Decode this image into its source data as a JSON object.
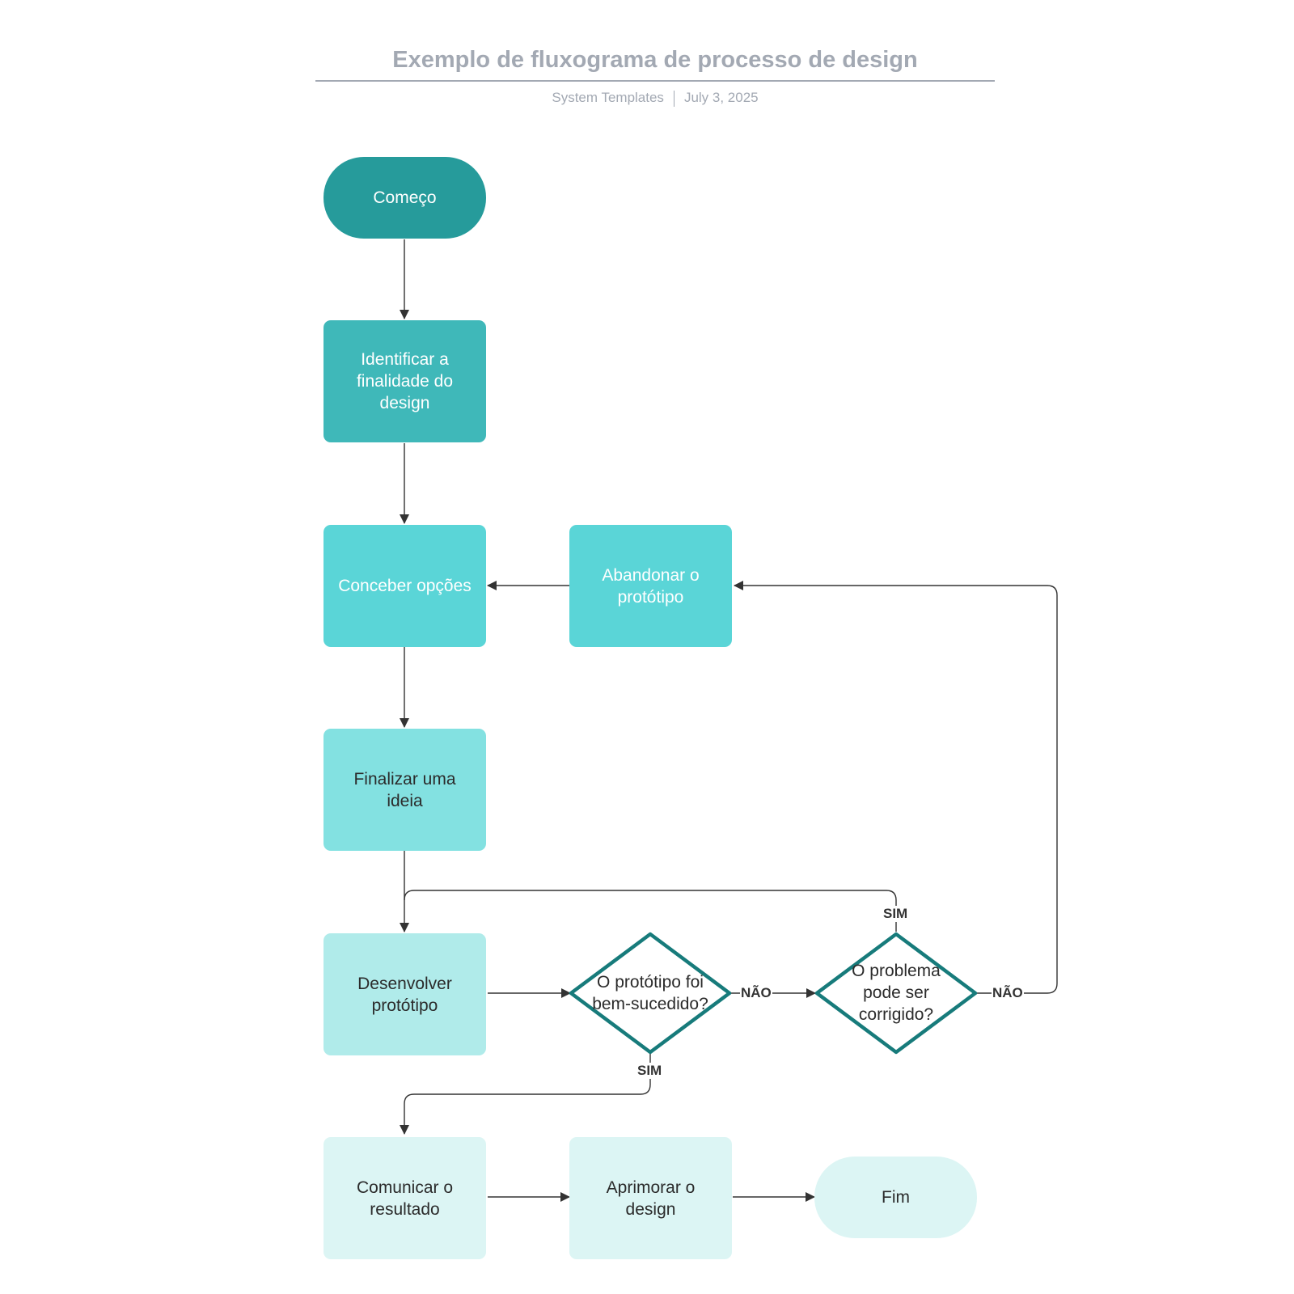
{
  "header": {
    "title": "Exemplo de fluxograma de processo de design",
    "author": "System Templates",
    "date": "July 3, 2025"
  },
  "colors": {
    "start": "#269b9b",
    "step1": "#3fb8b9",
    "step2": "#5ad5d7",
    "step3": "#83e1e1",
    "step4": "#b0ebea",
    "step5": "#dcf5f4",
    "decision_stroke": "#177b7b",
    "line": "#333333"
  },
  "nodes": {
    "start": "Começo",
    "identify": "Identificar a finalidade do design",
    "conceive": "Conceber opções",
    "abandon": "Abandonar o protótipo",
    "finalize": "Finalizar uma ideia",
    "develop": "Desenvolver protótipo",
    "decision1": "O protótipo foi bem-sucedido?",
    "decision2": "O problema pode ser corrigido?",
    "communicate": "Comunicar o resultado",
    "improve": "Aprimorar o design",
    "end": "Fim"
  },
  "edges": {
    "yes": "SIM",
    "no": "NÃO"
  }
}
